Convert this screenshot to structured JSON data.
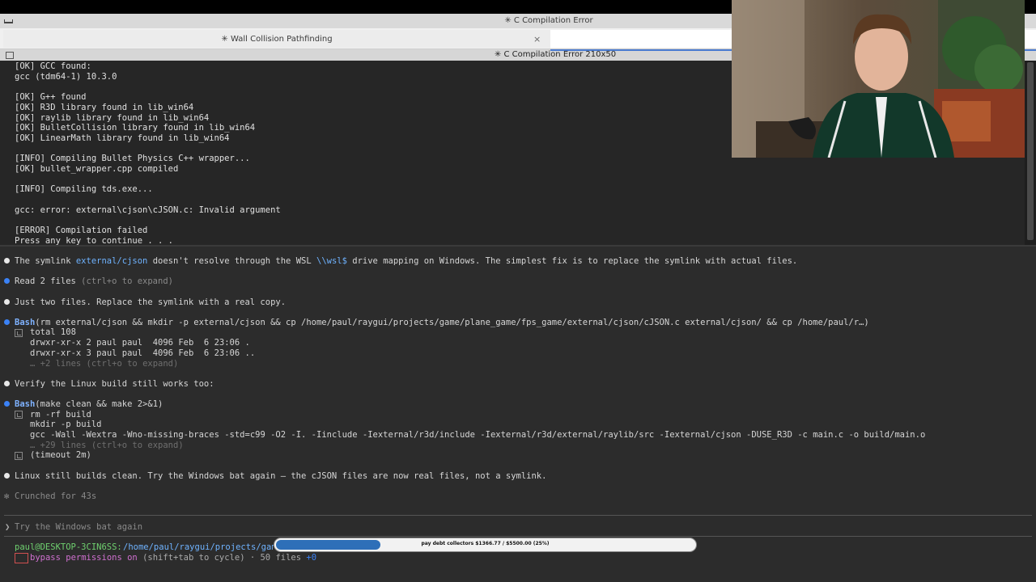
{
  "window": {
    "title": "✳ C Compilation Error"
  },
  "tabs": [
    {
      "label": "✳ Wall Collision Pathfinding",
      "close": "×"
    },
    {
      "label": ""
    }
  ],
  "pane": {
    "title": "✳ C Compilation Error 210x50"
  },
  "output_lines": [
    "[OK] GCC found:",
    "gcc (tdm64-1) 10.3.0",
    "",
    "[OK] G++ found",
    "[OK] R3D library found in lib_win64",
    "[OK] raylib library found in lib_win64",
    "[OK] BulletCollision library found in lib_win64",
    "[OK] LinearMath library found in lib_win64",
    "",
    "[INFO] Compiling Bullet Physics C++ wrapper...",
    "[OK] bullet_wrapper.cpp compiled",
    "",
    "[INFO] Compiling tds.exe...",
    "",
    "gcc: error: external\\cjson\\cJSON.c: Invalid argument",
    "",
    "[ERROR] Compilation failed",
    "Press any key to continue . . ."
  ],
  "conversation": {
    "msg1": {
      "before": "The symlink ",
      "link1": "external/cjson",
      "middle": " doesn't resolve through the WSL ",
      "link2": "\\\\wsl$",
      "after": " drive mapping on Windows. The simplest fix is to replace the symlink with actual files."
    },
    "read_files": {
      "label": "Read 2 files",
      "hint": " (ctrl+o to expand)"
    },
    "msg2": "Just two files. Replace the symlink with a real copy.",
    "bash1": {
      "keyword": "Bash",
      "command": "(rm external/cjson && mkdir -p external/cjson && cp /home/paul/raygui/projects/game/plane_game/fps_game/external/cjson/cJSON.c external/cjson/ && cp /home/paul/r…)",
      "output": [
        "total 108",
        "drwxr-xr-x 2 paul paul  4096 Feb  6 23:06 .",
        "drwxr-xr-x 3 paul paul  4096 Feb  6 23:06 .."
      ],
      "more": "… +2 lines (ctrl+o to expand)"
    },
    "msg3": "Verify the Linux build still works too:",
    "bash2": {
      "keyword": "Bash",
      "command": "(make clean && make 2>&1)",
      "output": [
        "rm -rf build",
        "mkdir -p build",
        "gcc -Wall -Wextra -Wno-missing-braces -std=c99 -O2 -I. -Iinclude -Iexternal/r3d/include -Iexternal/r3d/external/raylib/src -Iexternal/cjson -DUSE_R3D -c main.c -o build/main.o"
      ],
      "more": "… +29 lines (ctrl+o to expand)",
      "timeout": "(timeout 2m)"
    },
    "msg4": "Linux still builds clean. Try the Windows bat again — the cJSON files are now real files, not a symlink.",
    "status": {
      "star": "✻",
      "text": "Crunched for 43s"
    }
  },
  "prompt": {
    "chevron": "❯",
    "text": "Try the Windows bat again"
  },
  "footer": {
    "user": "paul@DESKTOP-3CIN6SS:",
    "path": "/home/paul/raygui/projects/game/plane_game/fps_game",
    "mode_label": "bypass permissions on",
    "rest": " (shift+tab to cycle) · 50 files ",
    "plus": "+0"
  },
  "progress": {
    "label": "pay debt collectors $1366.77 / $5500.00 (25%)",
    "fraction": 0.25
  },
  "colors": {
    "accent": "#4a7bd0",
    "bash_keyword": "#7fb2ff",
    "link": "#6fb3ff",
    "progress_fill": "#2e6fb8"
  }
}
